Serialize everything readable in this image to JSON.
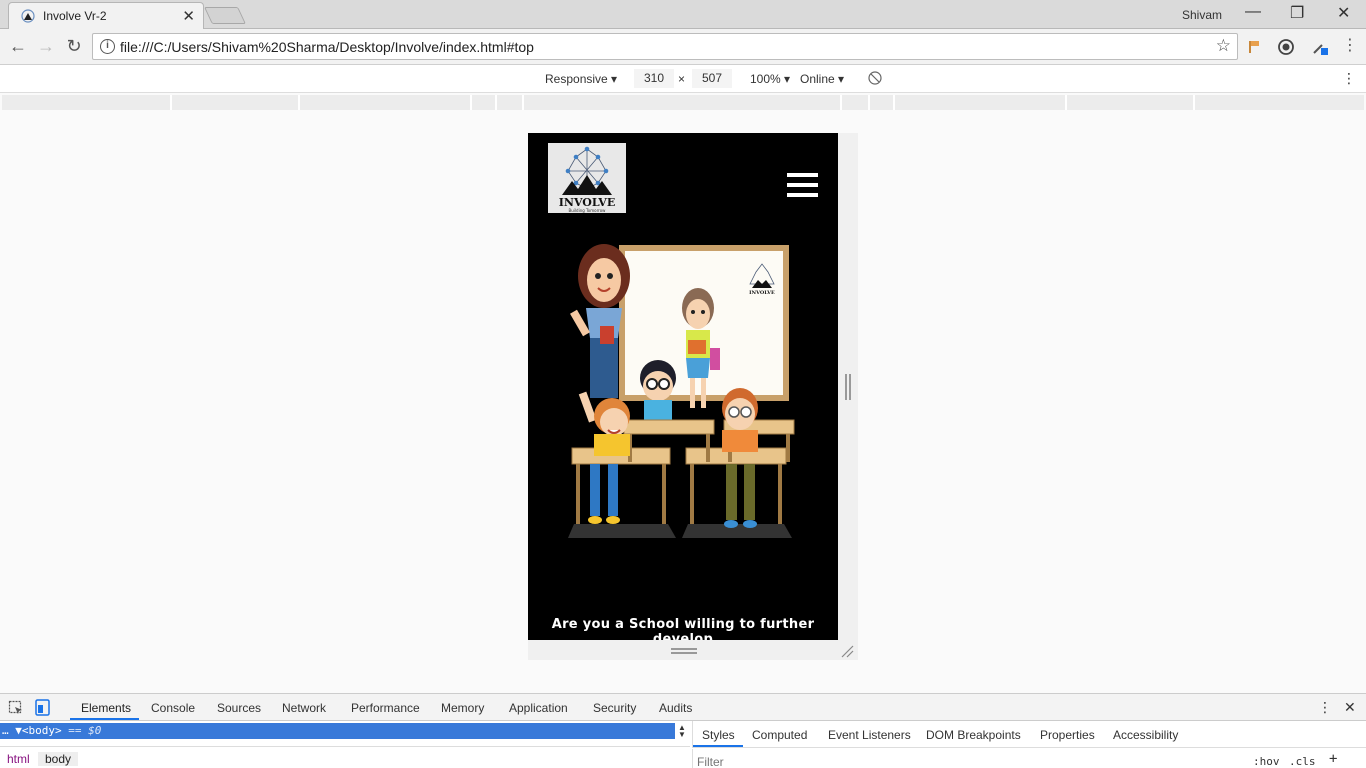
{
  "browser": {
    "tab_title": "Involve Vr-2",
    "profile_name": "Shivam",
    "url": "file:///C:/Users/Shivam%20Sharma/Desktop/Involve/index.html#top"
  },
  "device_toolbar": {
    "device": "Responsive",
    "width": "310",
    "times": "×",
    "height": "507",
    "zoom": "100%",
    "network": "Online"
  },
  "page": {
    "logo_text": "INVOLVE",
    "logo_tagline": "Building Tomorrow",
    "hero_text": "Are you a School willing to further develop",
    "board_logo_text": "INVOLVE"
  },
  "devtools": {
    "tabs": [
      "Elements",
      "Console",
      "Sources",
      "Network",
      "Performance",
      "Memory",
      "Application",
      "Security",
      "Audits"
    ],
    "active_tab": "Elements",
    "dom_selected": "▼<body>",
    "dom_marker": "== $0",
    "breadcrumbs": [
      "html",
      "body"
    ],
    "side_tabs": [
      "Styles",
      "Computed",
      "Event Listeners",
      "DOM Breakpoints",
      "Properties",
      "Accessibility"
    ],
    "filter_placeholder": "Filter",
    "hov": ":hov",
    "cls": ".cls",
    "plus": "+"
  },
  "colors": {
    "accent": "#1a73e8",
    "dom_selection": "#3879d9",
    "viewport_bg": "#000000"
  }
}
